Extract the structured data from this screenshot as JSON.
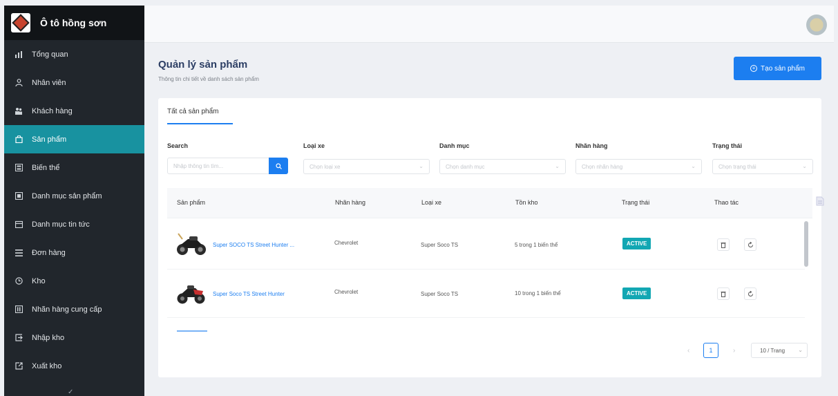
{
  "sidebar": {
    "brand": "Ô tô hồng sơn",
    "items": [
      {
        "label": "Tổng quan",
        "icon": "bar-chart-icon"
      },
      {
        "label": "Nhân viên",
        "icon": "user-icon"
      },
      {
        "label": "Khách hàng",
        "icon": "users-icon"
      },
      {
        "label": "Sản phẩm",
        "icon": "shopping-bag-icon",
        "active": true
      },
      {
        "label": "Biến thể",
        "icon": "list-icon"
      },
      {
        "label": "Danh mục sản phẩm",
        "icon": "folder-icon"
      },
      {
        "label": "Danh mục tin tức",
        "icon": "calendar-icon"
      },
      {
        "label": "Đơn hàng",
        "icon": "menu-icon"
      },
      {
        "label": "Kho",
        "icon": "clock-icon"
      },
      {
        "label": "Nhãn hàng cung cấp",
        "icon": "tag-icon"
      },
      {
        "label": "Nhập kho",
        "icon": "import-icon"
      },
      {
        "label": "Xuất kho",
        "icon": "export-icon"
      }
    ]
  },
  "page": {
    "title": "Quản lý sản phẩm",
    "subtitle": "Thông tin chi tiết về danh sách sản phẩm",
    "create_button": "Tạo sản phẩm"
  },
  "tabs": [
    {
      "label": "Tất cả sản phẩm"
    }
  ],
  "filters": {
    "search_label": "Search",
    "search_placeholder": "Nhập thông tin tìm...",
    "vehicle_type_label": "Loại xe",
    "vehicle_type_placeholder": "Chọn loại xe",
    "category_label": "Danh mục",
    "category_placeholder": "Chọn danh mục",
    "brand_label": "Nhãn hàng",
    "brand_placeholder": "Chọn nhãn hàng",
    "status_label": "Trạng thái",
    "status_placeholder": "Chọn trạng thái"
  },
  "table": {
    "headers": [
      "Sản phẩm",
      "Nhãn hàng",
      "Loại xe",
      "Tồn kho",
      "Trạng thái",
      "Thao tác"
    ],
    "rows": [
      {
        "name": "Super SOCO TS Street Hunter ...",
        "brand": "Chevrolet",
        "type": "Super Soco TS",
        "stock": "5 trong 1 biến thể",
        "status": "ACTIVE"
      },
      {
        "name": "Super Soco TS Street Hunter",
        "brand": "Chevrolet",
        "type": "Super Soco TS",
        "stock": "10 trong 1 biến thể",
        "status": "ACTIVE"
      }
    ]
  },
  "pagination": {
    "current_page": "1",
    "page_size": "10 / Trang"
  },
  "colors": {
    "sidebar_bg": "#21262c",
    "active_item": "#1892a0",
    "primary": "#1c7ef0",
    "badge": "#12a7b3"
  }
}
